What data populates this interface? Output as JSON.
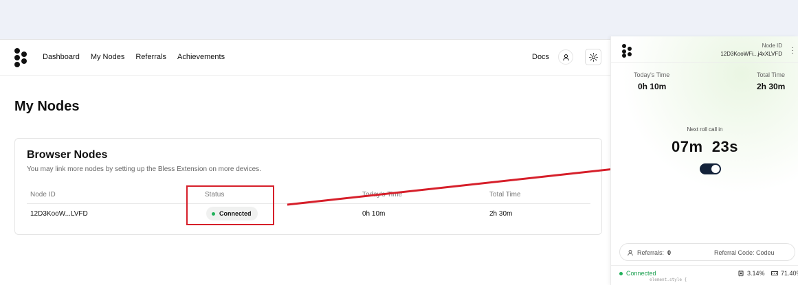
{
  "nav": {
    "links": [
      "Dashboard",
      "My Nodes",
      "Referrals",
      "Achievements"
    ],
    "docs": "Docs"
  },
  "page": {
    "title": "My Nodes"
  },
  "browser_nodes": {
    "title": "Browser Nodes",
    "subtitle": "You may link more nodes by setting up the Bless Extension on more devices.",
    "columns": [
      "Node ID",
      "Status",
      "Today's Time",
      "Total Time"
    ],
    "rows": [
      {
        "node_id": "12D3KooW...LVFD",
        "status": "Connected",
        "today": "0h 10m",
        "total": "2h 30m"
      }
    ]
  },
  "extension": {
    "node_id_label": "Node ID",
    "node_id": "12D3KooWFi...j4xXLVFD",
    "todays_time_label": "Today's Time",
    "todays_time": "0h 10m",
    "total_time_label": "Total Time",
    "total_time": "2h 30m",
    "next_roll_label": "Next roll call in",
    "countdown": "07m  23s",
    "toggle_on": true,
    "referrals_label": "Referrals:",
    "referrals_value": "0",
    "referral_code_label": "Referral Code: Codeu",
    "status": "Connected",
    "cpu": "3.14%",
    "memory": "71.40%"
  },
  "devtools_hint": "element.style {",
  "colors": {
    "accent_dark": "#14233a",
    "connected": "#20b15a",
    "annotation": "#d61f2a"
  },
  "icons": [
    "user-icon",
    "sun-icon",
    "kebab-icon",
    "user-icon",
    "cpu-icon",
    "memory-icon"
  ]
}
